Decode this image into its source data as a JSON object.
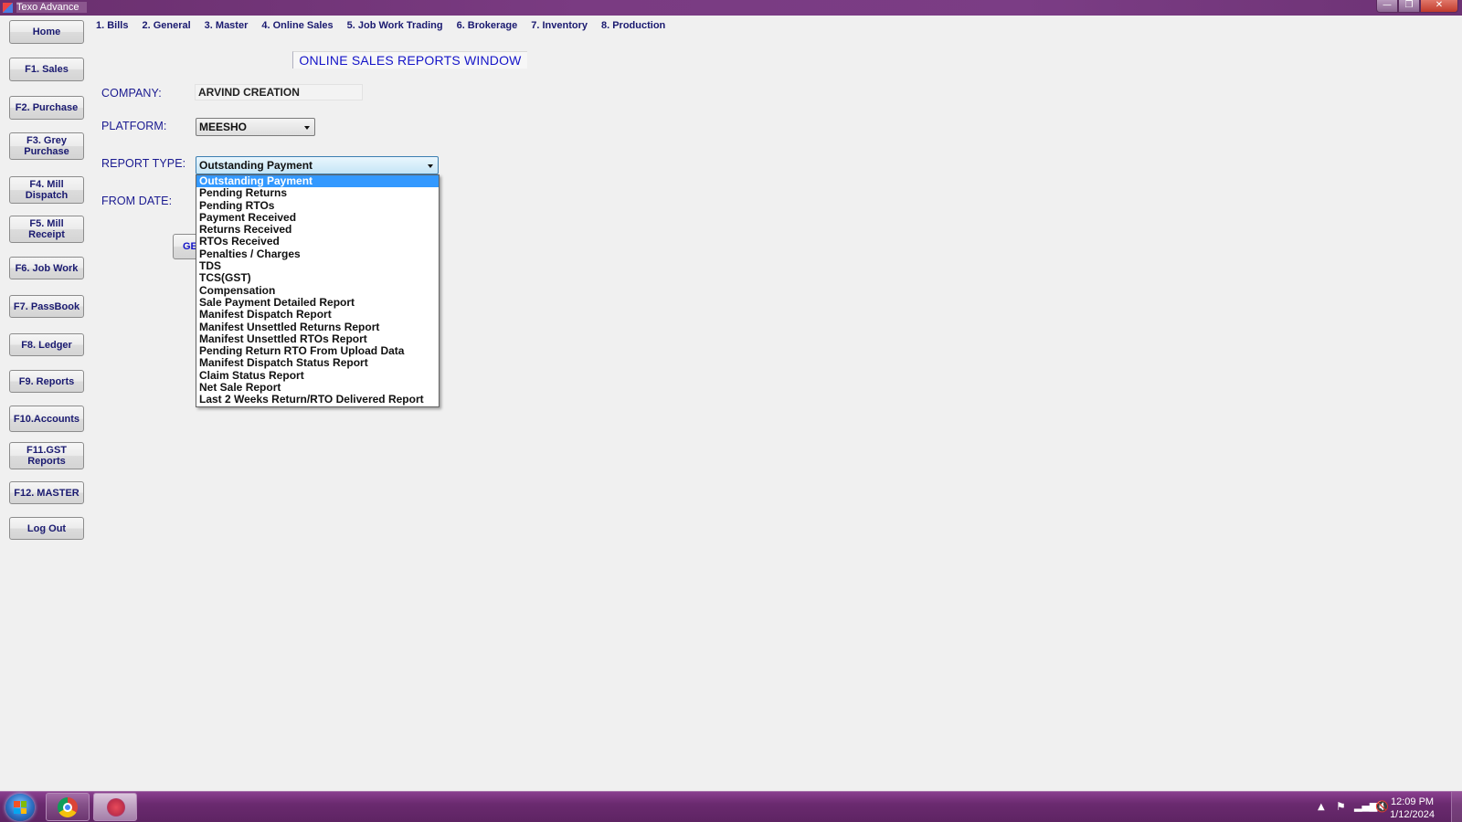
{
  "window": {
    "title": "Texo Advance",
    "controls": {
      "minimize": "—",
      "maximize": "❐",
      "close": "✕"
    }
  },
  "sidebar": {
    "items": [
      {
        "label": "Home"
      },
      {
        "label": "F1. Sales"
      },
      {
        "label": "F2. Purchase"
      },
      {
        "label": "F3. Grey\nPurchase"
      },
      {
        "label": "F4. Mill\nDispatch"
      },
      {
        "label": "F5. Mill\nReceipt"
      },
      {
        "label": "F6. Job Work"
      },
      {
        "label": "F7. PassBook"
      },
      {
        "label": "F8. Ledger"
      },
      {
        "label": "F9. Reports"
      },
      {
        "label": "F10.Accounts"
      },
      {
        "label": "F11.GST\nReports"
      },
      {
        "label": "F12. MASTER"
      },
      {
        "label": "Log Out"
      }
    ]
  },
  "topmenu": {
    "items": [
      {
        "label": "1. Bills"
      },
      {
        "label": "2. General"
      },
      {
        "label": "3. Master"
      },
      {
        "label": "4. Online Sales"
      },
      {
        "label": "5. Job Work Trading"
      },
      {
        "label": "6. Brokerage"
      },
      {
        "label": "7. Inventory"
      },
      {
        "label": "8. Production"
      }
    ]
  },
  "form": {
    "window_title": "ONLINE SALES REPORTS WINDOW",
    "company_label": "COMPANY:",
    "company_value": "ARVIND CREATION",
    "platform_label": "PLATFORM:",
    "platform_value": "MEESHO",
    "report_type_label": "REPORT TYPE:",
    "report_type_value": "Outstanding Payment",
    "from_date_label": "FROM DATE:",
    "generate_button_label": "GE"
  },
  "report_type_dropdown": {
    "selected_index": 0,
    "options": [
      "Outstanding Payment",
      "Pending Returns",
      "Pending RTOs",
      "Payment Received",
      "Returns Received",
      "RTOs Received",
      "Penalties / Charges",
      "TDS",
      "TCS(GST)",
      "Compensation",
      "Sale Payment Detailed Report",
      "Manifest Dispatch Report",
      "Manifest Unsettled Returns Report",
      "Manifest Unsettled RTOs Report",
      "Pending Return RTO From Upload Data",
      "Manifest Dispatch Status Report",
      "Claim Status Report",
      "Net Sale Report",
      "Last 2 Weeks Return/RTO Delivered Report"
    ]
  },
  "taskbar": {
    "apps": [
      {
        "name": "chrome",
        "icon": "chrome-icon"
      },
      {
        "name": "texo-advance",
        "icon": "app-icon",
        "active": true
      }
    ],
    "tray": {
      "time": "12:09 PM",
      "date": "1/12/2024",
      "icons": [
        "show-hidden-icon",
        "action-center-icon",
        "network-icon",
        "volume-muted-icon"
      ]
    }
  },
  "colors": {
    "accent_purple": "#7a3b82",
    "label_blue": "#1a1a90",
    "title_blue": "#1414c8",
    "selection_blue": "#3399ff"
  }
}
